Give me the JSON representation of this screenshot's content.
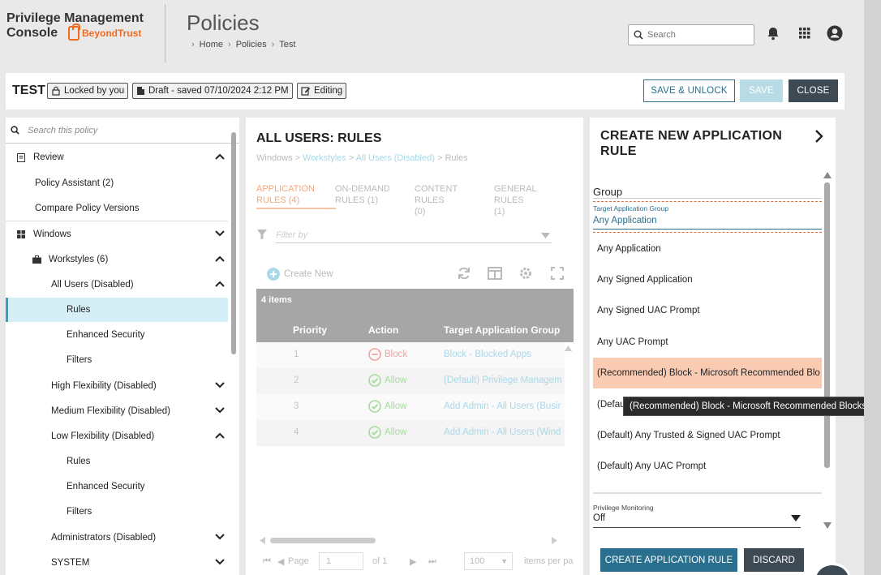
{
  "app": {
    "logo_line1": "Privilege Management",
    "logo_line2": "Console",
    "logo_brand": "BeyondTrust",
    "page_title": "Policies",
    "breadcrumb": [
      "Home",
      "Policies",
      "Test"
    ],
    "search_placeholder": "Search"
  },
  "toolbar": {
    "title": "TEST",
    "locked": "Locked by you",
    "draft": "Draft - saved 07/10/2024 2:12 PM",
    "editing": "Editing",
    "save_unlock": "SAVE & UNLOCK",
    "save": "SAVE",
    "close": "CLOSE"
  },
  "sidebar": {
    "search_placeholder": "Search this policy",
    "items": [
      {
        "label": "Review"
      },
      {
        "label": "Policy Assistant (2)"
      },
      {
        "label": "Compare Policy Versions"
      },
      {
        "label": "Windows"
      },
      {
        "label": "Workstyles (6)"
      },
      {
        "label": "All Users (Disabled)"
      },
      {
        "label": "Rules"
      },
      {
        "label": "Enhanced Security"
      },
      {
        "label": "Filters"
      },
      {
        "label": "High Flexibility (Disabled)"
      },
      {
        "label": "Medium Flexibility (Disabled)"
      },
      {
        "label": "Low Flexibility (Disabled)"
      },
      {
        "label": "Rules"
      },
      {
        "label": "Enhanced Security"
      },
      {
        "label": "Filters"
      },
      {
        "label": "Administrators (Disabled)"
      },
      {
        "label": "SYSTEM"
      }
    ]
  },
  "middle": {
    "title": "ALL USERS: RULES",
    "crumb": {
      "c1": "Windows",
      "c2": "Workstyles",
      "c3": "All Users (Disabled)",
      "c4": "Rules"
    },
    "tabs": [
      {
        "l1": "APPLICATION",
        "l2": "RULES (4)"
      },
      {
        "l1": "ON-DEMAND",
        "l2": "RULES (1)"
      },
      {
        "l1": "CONTENT RULES",
        "l2": "(0)"
      },
      {
        "l1": "GENERAL RULES",
        "l2": "(1)"
      }
    ],
    "filter_placeholder": "Filter by",
    "create_new": "Create New",
    "count": "4 items",
    "columns": {
      "priority": "Priority",
      "action": "Action",
      "target": "Target Application Group"
    },
    "rows": [
      {
        "priority": "1",
        "action": "Block",
        "target": "Block - Blocked Apps"
      },
      {
        "priority": "2",
        "action": "Allow",
        "target": "(Default) Privilege Managem"
      },
      {
        "priority": "3",
        "action": "Allow",
        "target": "Add Admin - All Users (Busir"
      },
      {
        "priority": "4",
        "action": "Allow",
        "target": "Add Admin - All Users (Wind"
      }
    ],
    "pager": {
      "page_label": "Page",
      "page_value": "1",
      "of": "of 1",
      "per_page": "100",
      "per_page_label": "items per pa"
    }
  },
  "right": {
    "title": "CREATE NEW APPLICATION RULE",
    "group_label": "Group",
    "target_label": "Target Application Group",
    "target_value": "Any Application",
    "options": [
      "Any Application",
      "Any Signed Application",
      "Any Signed UAC Prompt",
      "Any UAC Prompt",
      "(Recommended) Block - Microsoft Recommended Blo",
      "(Defau",
      "(Default) Any Trusted & Signed UAC Prompt",
      "(Default) Any UAC Prompt"
    ],
    "pm_label": "Privilege Monitoring",
    "pm_value": "Off",
    "create_btn": "CREATE APPLICATION RULE",
    "discard_btn": "DISCARD"
  },
  "tooltip": "(Recommended) Block - Microsoft Recommended Blocks",
  "colors": {
    "accent": "#2a6f8e",
    "highlight": "#f9cbb3",
    "brand": "#f26a21"
  }
}
